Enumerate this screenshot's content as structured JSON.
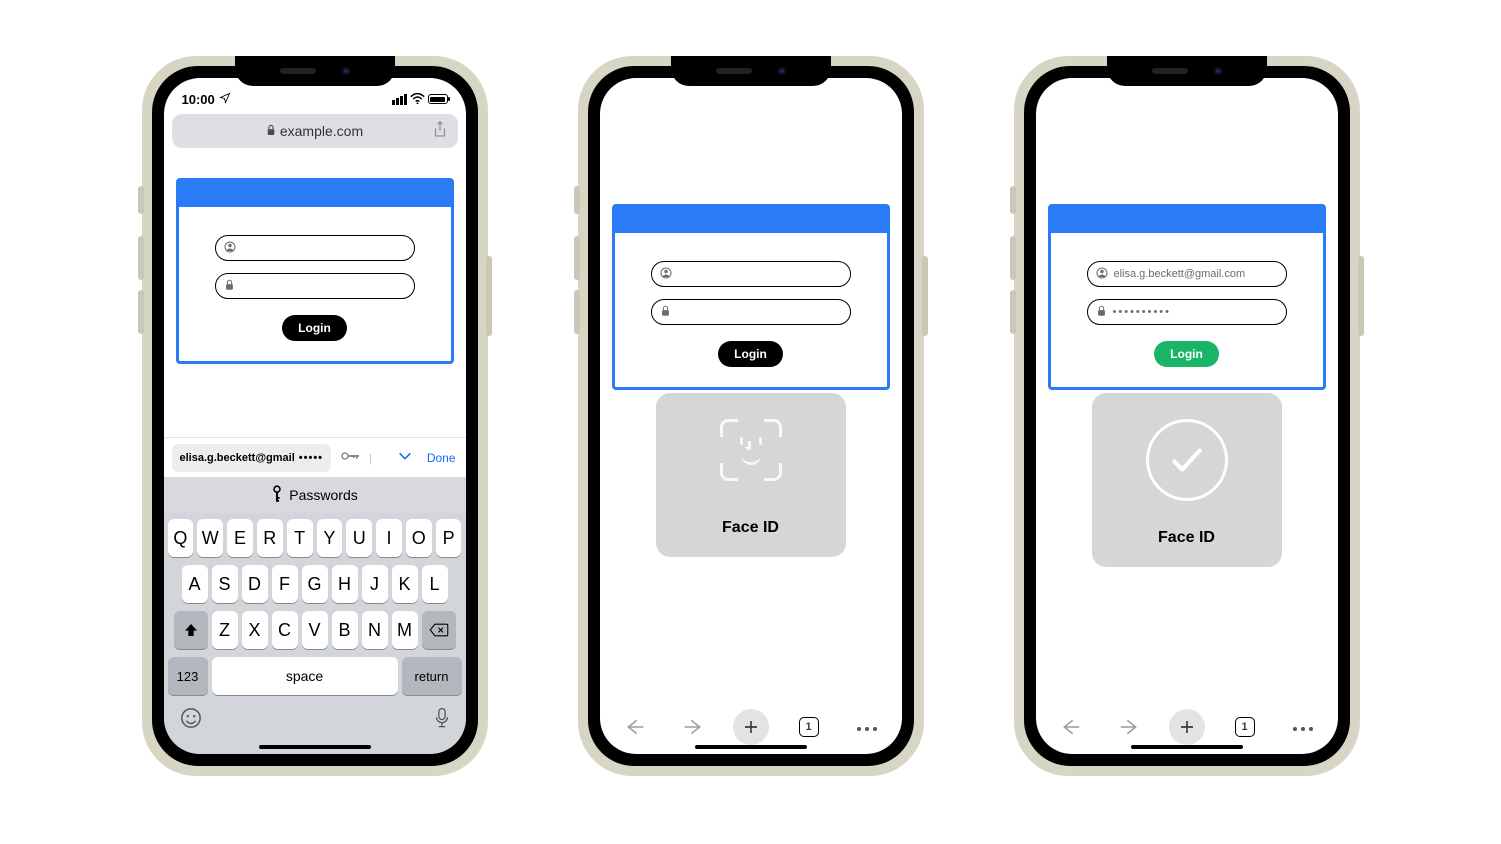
{
  "statusbar": {
    "time": "10:00"
  },
  "safari": {
    "url": "example.com"
  },
  "login": {
    "button_label": "Login",
    "username_placeholder": "",
    "password_placeholder": "",
    "filled_username": "elisa.g.beckett@gmail.com",
    "filled_password_mask": "••••••••••"
  },
  "faceid": {
    "label": "Face ID"
  },
  "autofill": {
    "suggestion_email_trunc": "elisa.g.beckett@gmail",
    "suggestion_mask": "•••••",
    "done_label": "Done",
    "passwords_label": "Passwords"
  },
  "keyboard": {
    "row1": [
      "Q",
      "W",
      "E",
      "R",
      "T",
      "Y",
      "U",
      "I",
      "O",
      "P"
    ],
    "row2": [
      "A",
      "S",
      "D",
      "F",
      "G",
      "H",
      "J",
      "K",
      "L"
    ],
    "row3": [
      "Z",
      "X",
      "C",
      "V",
      "B",
      "N",
      "M"
    ],
    "numkey": "123",
    "space": "space",
    "return": "return"
  },
  "toolbar": {
    "tab_count": "1"
  }
}
